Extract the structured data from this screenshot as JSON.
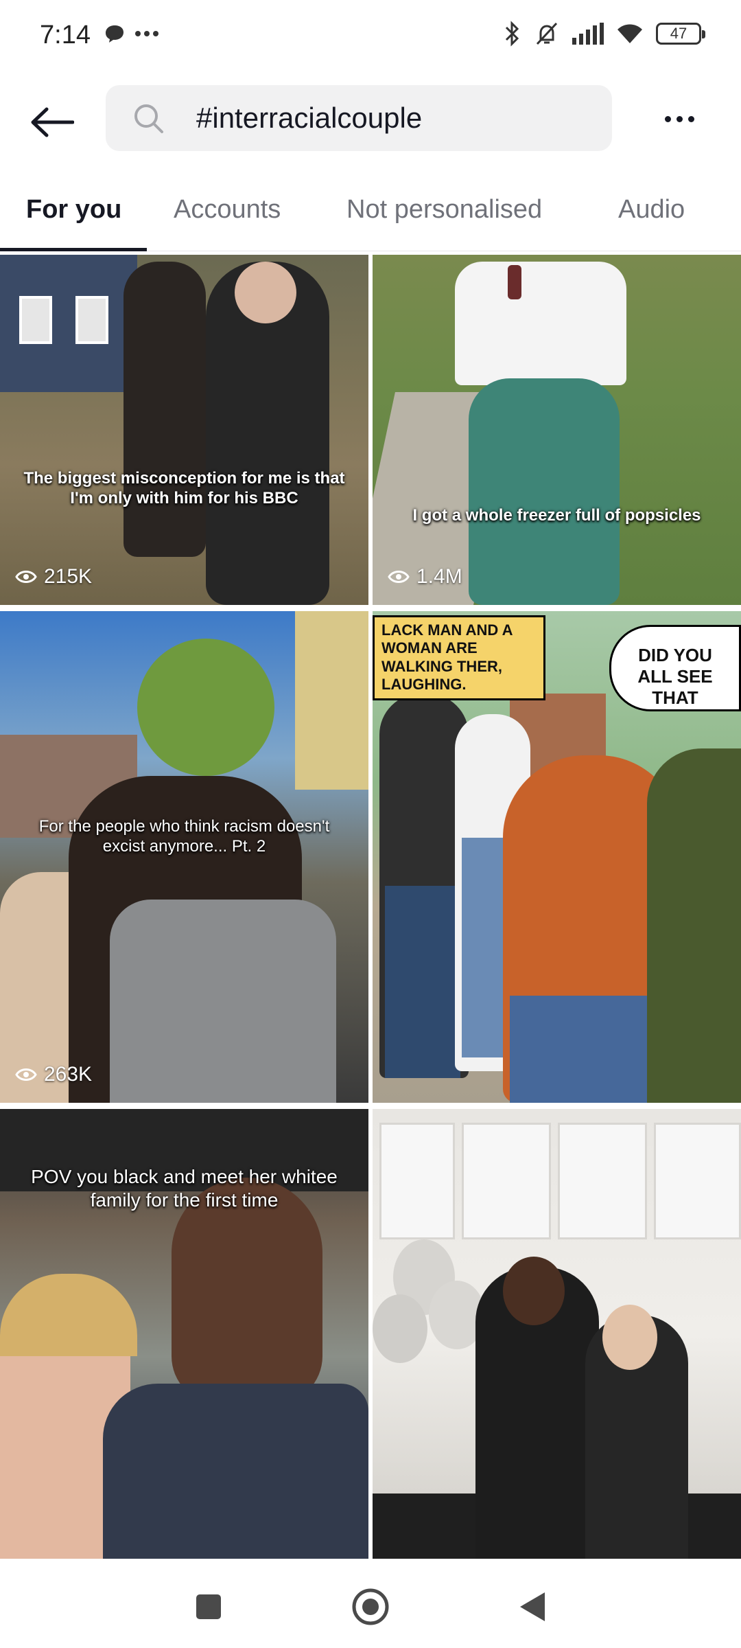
{
  "status_bar": {
    "time": "7:14",
    "battery": "47",
    "left_icons": [
      "chat-bubble-icon",
      "more-dots-icon"
    ],
    "right_icons": [
      "bluetooth-icon",
      "bell-off-icon",
      "signal-icon",
      "wifi-icon",
      "battery-icon"
    ]
  },
  "search": {
    "query": "#interracialcouple"
  },
  "tabs": [
    {
      "label": "For you",
      "active": true
    },
    {
      "label": "Accounts",
      "active": false
    },
    {
      "label": "Not personalised",
      "active": false
    },
    {
      "label": "Audio",
      "active": false
    }
  ],
  "results": [
    {
      "caption": "The biggest misconception for me is that I'm only with him for his BBC",
      "views": "215K"
    },
    {
      "caption": "I got a whole freezer full of popsicles",
      "views": "1.4M"
    },
    {
      "caption": "For the people who think racism doesn't excist anymore... Pt. 2",
      "views": "263K"
    },
    {
      "caption_box": "LACK MAN AND A WOMAN ARE WALKING THER, LAUGHING.",
      "speech_bubble": "DID YOU ALL SEE THAT"
    },
    {
      "caption": "POV you black and meet her whitee family for the first time"
    },
    {}
  ],
  "colors": {
    "accent": "#161823",
    "inactive_tab": "#6f7179",
    "search_bg": "#f1f1f2"
  },
  "navbar": {
    "icons": [
      "square-recents-icon",
      "circle-home-icon",
      "triangle-back-icon"
    ]
  }
}
